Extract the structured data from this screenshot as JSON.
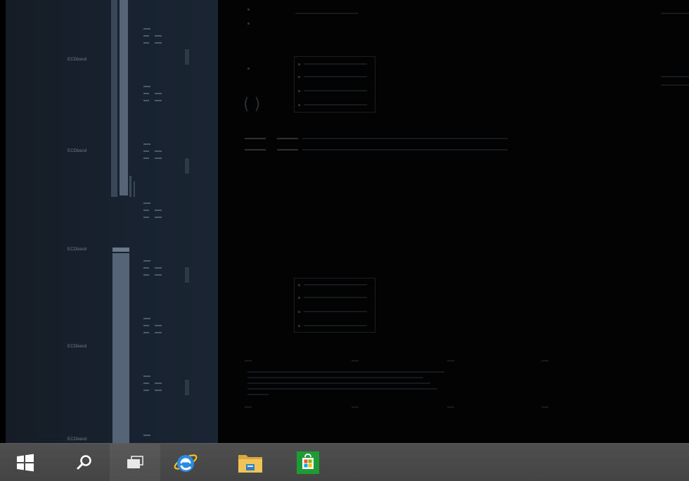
{
  "desktop": {
    "left_panel_labels": [
      "ECDband",
      "ECDband",
      "ECDband",
      "ECDband",
      "ECDband"
    ]
  },
  "taskbar": {
    "items": [
      {
        "name": "start",
        "icon": "windows-logo-icon"
      },
      {
        "name": "search",
        "icon": "search-icon"
      },
      {
        "name": "task-view",
        "icon": "task-view-icon"
      },
      {
        "name": "internet-explorer",
        "icon": "internet-explorer-icon"
      },
      {
        "name": "file-explorer",
        "icon": "folder-icon"
      },
      {
        "name": "store",
        "icon": "store-icon"
      }
    ],
    "colors": {
      "bar": "#4a4a4b",
      "store_green": "#1f9b35",
      "ie_blue": "#2b8be0",
      "folder_yellow": "#e3b64a"
    }
  }
}
